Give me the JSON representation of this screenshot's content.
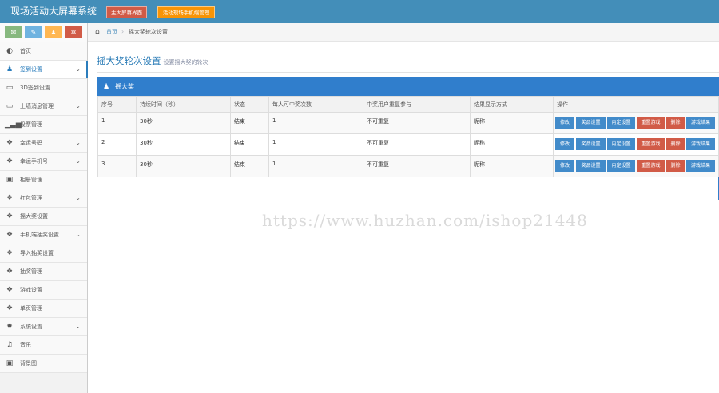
{
  "app": {
    "title": "现场活动大屏幕系统"
  },
  "topbar": {
    "btn_main_screen": "主大屏幕界面",
    "btn_mobile": "活动现场手机端管理"
  },
  "shortcuts": [
    {
      "icon": "chat-icon",
      "glyph": "✉"
    },
    {
      "icon": "pencil-icon",
      "glyph": "✎"
    },
    {
      "icon": "users-icon",
      "glyph": "♟"
    },
    {
      "icon": "cogs-icon",
      "glyph": "✲"
    }
  ],
  "sidebar": {
    "items": [
      {
        "label": "首页",
        "icon": "dashboard-icon",
        "glyph": "◐",
        "arrow": ""
      },
      {
        "label": "签到设置",
        "icon": "users-icon",
        "glyph": "♟",
        "arrow": "⌄"
      },
      {
        "label": "3D签到设置",
        "icon": "desktop-icon",
        "glyph": "▭",
        "arrow": ""
      },
      {
        "label": "上墙消息管理",
        "icon": "desktop-icon",
        "glyph": "▭",
        "arrow": "⌄"
      },
      {
        "label": "投票管理",
        "icon": "signal-icon",
        "glyph": "▁▃▅",
        "arrow": ""
      },
      {
        "label": "幸运号码",
        "icon": "gift-icon",
        "glyph": "❖",
        "arrow": "⌄"
      },
      {
        "label": "幸运手机号",
        "icon": "gift-icon",
        "glyph": "❖",
        "arrow": "⌄"
      },
      {
        "label": "相册管理",
        "icon": "picture-icon",
        "glyph": "▣",
        "arrow": ""
      },
      {
        "label": "红包管理",
        "icon": "gift-icon",
        "glyph": "❖",
        "arrow": "⌄"
      },
      {
        "label": "摇大奖设置",
        "icon": "gift-icon",
        "glyph": "❖",
        "arrow": ""
      },
      {
        "label": "手机端抽奖设置",
        "icon": "gift-icon",
        "glyph": "❖",
        "arrow": "⌄"
      },
      {
        "label": "导入抽奖设置",
        "icon": "gift-icon",
        "glyph": "❖",
        "arrow": ""
      },
      {
        "label": "抽奖管理",
        "icon": "gift-icon",
        "glyph": "❖",
        "arrow": ""
      },
      {
        "label": "游戏设置",
        "icon": "gift-icon",
        "glyph": "❖",
        "arrow": ""
      },
      {
        "label": "单页管理",
        "icon": "gift-icon",
        "glyph": "❖",
        "arrow": ""
      },
      {
        "label": "系统设置",
        "icon": "gear-icon",
        "glyph": "✹",
        "arrow": "⌄"
      },
      {
        "label": "音乐",
        "icon": "music-icon",
        "glyph": "♫",
        "arrow": ""
      },
      {
        "label": "背景图",
        "icon": "picture-icon",
        "glyph": "▣",
        "arrow": ""
      }
    ]
  },
  "breadcrumb": {
    "home_glyph": "⌂",
    "home": "首页",
    "sep": "›",
    "current": "摇大奖轮次设置"
  },
  "page": {
    "title": "摇大奖轮次设置",
    "subtitle": "设置摇大奖的轮次"
  },
  "widget": {
    "title": "摇大奖",
    "icon_glyph": "♟"
  },
  "table": {
    "headers": [
      "序号",
      "持续时间（秒）",
      "状态",
      "每人可中奖次数",
      "中奖用户重复参与",
      "结果显示方式",
      "操作"
    ],
    "rows": [
      {
        "id": "1",
        "duration": "30秒",
        "status": "结束",
        "wins": "1",
        "repeat": "不可重复",
        "display": "昵称"
      },
      {
        "id": "2",
        "duration": "30秒",
        "status": "结束",
        "wins": "1",
        "repeat": "不可重复",
        "display": "昵称"
      },
      {
        "id": "3",
        "duration": "30秒",
        "status": "结束",
        "wins": "1",
        "repeat": "不可重复",
        "display": "昵称"
      }
    ],
    "actions": {
      "edit": "修改",
      "prize": "奖品设置",
      "preset": "内定设置",
      "restart": "重置游戏",
      "delete": "删除",
      "result": "游戏结果"
    }
  },
  "watermark": "https://www.huzhan.com/ishop21448",
  "colors": {
    "topbar": "#438eb9",
    "widget": "#307ecc",
    "blue_btn": "#428bca",
    "red_btn": "#d15b47",
    "orange_btn": "#f89406"
  }
}
